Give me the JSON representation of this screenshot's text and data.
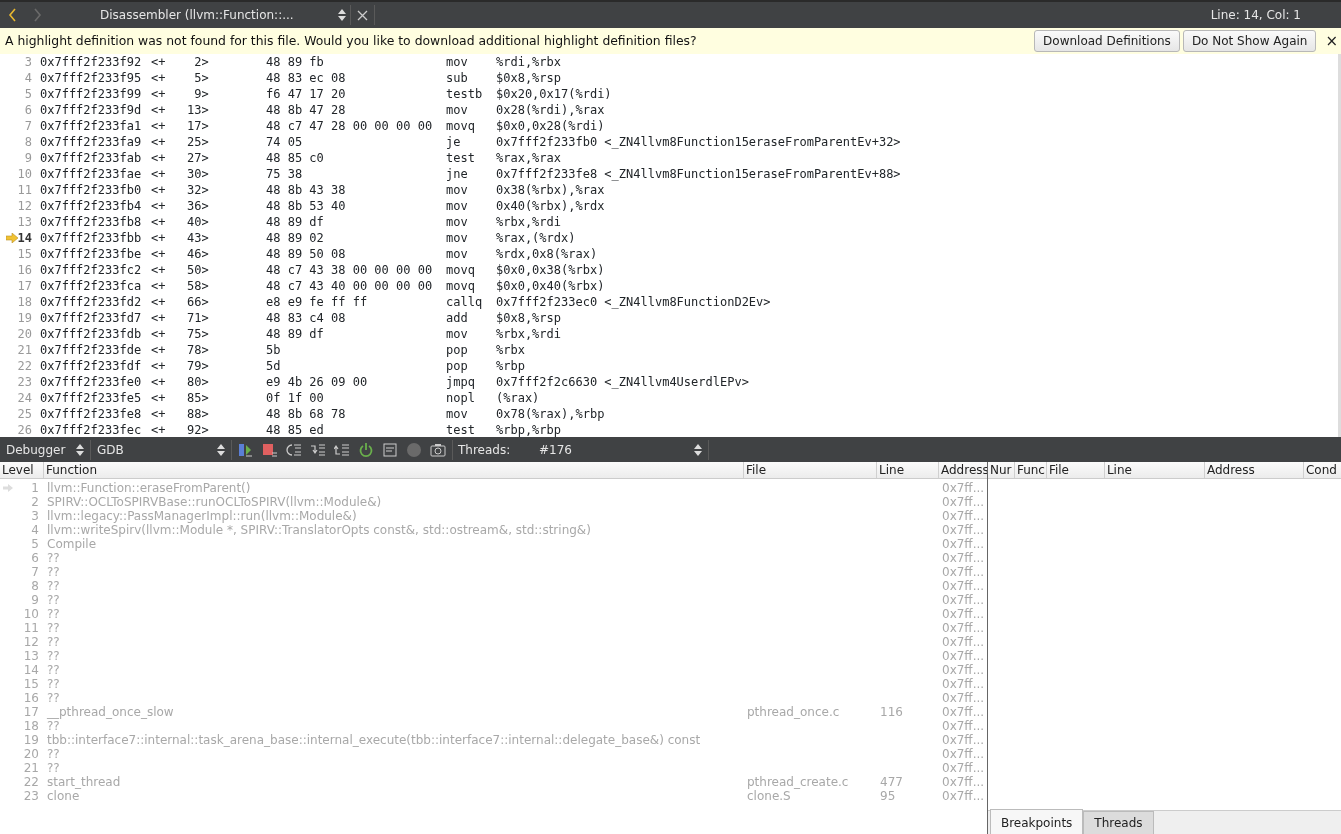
{
  "editor_toolbar": {
    "nav": [
      {
        "kind": "back",
        "disabled": false
      },
      {
        "kind": "forward",
        "disabled": true
      }
    ],
    "document": "Disassembler (llvm::Function::...",
    "position": "Line: 14, Col: 1"
  },
  "infobar": {
    "message": "A highlight definition was not found for this file. Would you like to download additional highlight definition files?",
    "buttons": [
      "Download Definitions",
      "Do Not Show Again"
    ],
    "close": "×"
  },
  "disassembly": [
    {
      "line": "3",
      "address": "0x7fff2f233f92",
      "offset": "<+    2>",
      "bytes": "48 89 fb",
      "op": "mov",
      "args": "%rdi,%rbx",
      "current": false
    },
    {
      "line": "4",
      "address": "0x7fff2f233f95",
      "offset": "<+    5>",
      "bytes": "48 83 ec 08",
      "op": "sub",
      "args": "$0x8,%rsp",
      "current": false
    },
    {
      "line": "5",
      "address": "0x7fff2f233f99",
      "offset": "<+    9>",
      "bytes": "f6 47 17 20",
      "op": "testb",
      "args": "$0x20,0x17(%rdi)",
      "current": false
    },
    {
      "line": "6",
      "address": "0x7fff2f233f9d",
      "offset": "<+   13>",
      "bytes": "48 8b 47 28",
      "op": "mov",
      "args": "0x28(%rdi),%rax",
      "current": false
    },
    {
      "line": "7",
      "address": "0x7fff2f233fa1",
      "offset": "<+   17>",
      "bytes": "48 c7 47 28 00 00 00 00",
      "op": "movq",
      "args": "$0x0,0x28(%rdi)",
      "current": false
    },
    {
      "line": "8",
      "address": "0x7fff2f233fa9",
      "offset": "<+   25>",
      "bytes": "74 05",
      "op": "je",
      "args": "0x7fff2f233fb0 <_ZN4llvm8Function15eraseFromParentEv+32>",
      "current": false
    },
    {
      "line": "9",
      "address": "0x7fff2f233fab",
      "offset": "<+   27>",
      "bytes": "48 85 c0",
      "op": "test",
      "args": "%rax,%rax",
      "current": false
    },
    {
      "line": "10",
      "address": "0x7fff2f233fae",
      "offset": "<+   30>",
      "bytes": "75 38",
      "op": "jne",
      "args": "0x7fff2f233fe8 <_ZN4llvm8Function15eraseFromParentEv+88>",
      "current": false
    },
    {
      "line": "11",
      "address": "0x7fff2f233fb0",
      "offset": "<+   32>",
      "bytes": "48 8b 43 38",
      "op": "mov",
      "args": "0x38(%rbx),%rax",
      "current": false
    },
    {
      "line": "12",
      "address": "0x7fff2f233fb4",
      "offset": "<+   36>",
      "bytes": "48 8b 53 40",
      "op": "mov",
      "args": "0x40(%rbx),%rdx",
      "current": false
    },
    {
      "line": "13",
      "address": "0x7fff2f233fb8",
      "offset": "<+   40>",
      "bytes": "48 89 df",
      "op": "mov",
      "args": "%rbx,%rdi",
      "current": false
    },
    {
      "line": "14",
      "address": "0x7fff2f233fbb",
      "offset": "<+   43>",
      "bytes": "48 89 02",
      "op": "mov",
      "args": "%rax,(%rdx)",
      "current": true
    },
    {
      "line": "15",
      "address": "0x7fff2f233fbe",
      "offset": "<+   46>",
      "bytes": "48 89 50 08",
      "op": "mov",
      "args": "%rdx,0x8(%rax)",
      "current": false
    },
    {
      "line": "16",
      "address": "0x7fff2f233fc2",
      "offset": "<+   50>",
      "bytes": "48 c7 43 38 00 00 00 00",
      "op": "movq",
      "args": "$0x0,0x38(%rbx)",
      "current": false
    },
    {
      "line": "17",
      "address": "0x7fff2f233fca",
      "offset": "<+   58>",
      "bytes": "48 c7 43 40 00 00 00 00",
      "op": "movq",
      "args": "$0x0,0x40(%rbx)",
      "current": false
    },
    {
      "line": "18",
      "address": "0x7fff2f233fd2",
      "offset": "<+   66>",
      "bytes": "e8 e9 fe ff ff",
      "op": "callq",
      "args": "0x7fff2f233ec0 <_ZN4llvm8FunctionD2Ev>",
      "current": false
    },
    {
      "line": "19",
      "address": "0x7fff2f233fd7",
      "offset": "<+   71>",
      "bytes": "48 83 c4 08",
      "op": "add",
      "args": "$0x8,%rsp",
      "current": false
    },
    {
      "line": "20",
      "address": "0x7fff2f233fdb",
      "offset": "<+   75>",
      "bytes": "48 89 df",
      "op": "mov",
      "args": "%rbx,%rdi",
      "current": false
    },
    {
      "line": "21",
      "address": "0x7fff2f233fde",
      "offset": "<+   78>",
      "bytes": "5b",
      "op": "pop",
      "args": "%rbx",
      "current": false
    },
    {
      "line": "22",
      "address": "0x7fff2f233fdf",
      "offset": "<+   79>",
      "bytes": "5d",
      "op": "pop",
      "args": "%rbp",
      "current": false
    },
    {
      "line": "23",
      "address": "0x7fff2f233fe0",
      "offset": "<+   80>",
      "bytes": "e9 4b 26 09 00",
      "op": "jmpq",
      "args": "0x7fff2f2c6630 <_ZN4llvm4UserdlEPv>",
      "current": false
    },
    {
      "line": "24",
      "address": "0x7fff2f233fe5",
      "offset": "<+   85>",
      "bytes": "0f 1f 00",
      "op": "nopl",
      "args": "(%rax)",
      "current": false
    },
    {
      "line": "25",
      "address": "0x7fff2f233fe8",
      "offset": "<+   88>",
      "bytes": "48 8b 68 78",
      "op": "mov",
      "args": "0x78(%rax),%rbp",
      "current": false
    },
    {
      "line": "26",
      "address": "0x7fff2f233fec",
      "offset": "<+   92>",
      "bytes": "48 85 ed",
      "op": "test",
      "args": "%rbp,%rbp",
      "current": false
    }
  ],
  "debug_toolbar": {
    "perspective": "Debugger",
    "engine": "GDB",
    "tools": [
      {
        "kind": "continue"
      },
      {
        "kind": "stop"
      },
      {
        "kind": "step-over"
      },
      {
        "kind": "step-into"
      },
      {
        "kind": "step-out"
      },
      {
        "kind": "restart"
      },
      {
        "kind": "instruction"
      },
      {
        "kind": "record"
      },
      {
        "kind": "snapshot"
      }
    ],
    "threads_label": "Threads:",
    "thread": "#176"
  },
  "stack": {
    "columns": [
      "Level",
      "Function",
      "File",
      "Line",
      "Address"
    ],
    "rows": [
      {
        "level": "1",
        "function": "llvm::Function::eraseFromParent()",
        "file": "",
        "line": "",
        "address": "0x7ff...",
        "current": true
      },
      {
        "level": "2",
        "function": "SPIRV::OCLToSPIRVBase::runOCLToSPIRV(llvm::Module&)",
        "address": "0x7ff...",
        "current": false
      },
      {
        "level": "3",
        "function": "llvm::legacy::PassManagerImpl::run(llvm::Module&)",
        "address": "0x7ff...",
        "current": false
      },
      {
        "level": "4",
        "function": "llvm::writeSpirv(llvm::Module *, SPIRV::TranslatorOpts const&, std::ostream&, std::string&)",
        "address": "0x7ff...",
        "current": false
      },
      {
        "level": "5",
        "function": "Compile",
        "address": "0x7ff...",
        "current": false
      },
      {
        "level": "6",
        "function": "??",
        "address": "0x7ff...",
        "current": false
      },
      {
        "level": "7",
        "function": "??",
        "address": "0x7ff...",
        "current": false
      },
      {
        "level": "8",
        "function": "??",
        "address": "0x7ff...",
        "current": false
      },
      {
        "level": "9",
        "function": "??",
        "address": "0x7ff...",
        "current": false
      },
      {
        "level": "10",
        "function": "??",
        "address": "0x7ff...",
        "current": false
      },
      {
        "level": "11",
        "function": "??",
        "address": "0x7ff...",
        "current": false
      },
      {
        "level": "12",
        "function": "??",
        "address": "0x7ff...",
        "current": false
      },
      {
        "level": "13",
        "function": "??",
        "address": "0x7ff...",
        "current": false
      },
      {
        "level": "14",
        "function": "??",
        "address": "0x7ff...",
        "current": false
      },
      {
        "level": "15",
        "function": "??",
        "address": "0x7ff...",
        "current": false
      },
      {
        "level": "16",
        "function": "??",
        "address": "0x7ff...",
        "current": false
      },
      {
        "level": "17",
        "function": "__pthread_once_slow",
        "file": "pthread_once.c",
        "line": "116",
        "address": "0x7ff...",
        "current": false
      },
      {
        "level": "18",
        "function": "??",
        "address": "0x7ff...",
        "current": false
      },
      {
        "level": "19",
        "function": "tbb::interface7::internal::task_arena_base::internal_execute(tbb::interface7::internal::delegate_base&) const",
        "address": "0x7ff...",
        "current": false
      },
      {
        "level": "20",
        "function": "??",
        "address": "0x7ff...",
        "current": false
      },
      {
        "level": "21",
        "function": "??",
        "address": "0x7ff...",
        "current": false
      },
      {
        "level": "22",
        "function": "start_thread",
        "file": "pthread_create.c",
        "line": "477",
        "address": "0x7ff...",
        "current": false
      },
      {
        "level": "23",
        "function": "clone",
        "file": "clone.S",
        "line": "95",
        "address": "0x7ff...",
        "current": false
      }
    ]
  },
  "breakpoints": {
    "columns": [
      "Nur",
      "Func",
      "File",
      "Line",
      "Address",
      "Cond"
    ]
  },
  "tabs": [
    {
      "label": "Breakpoints",
      "selected": true
    },
    {
      "label": "Threads",
      "selected": false
    }
  ]
}
